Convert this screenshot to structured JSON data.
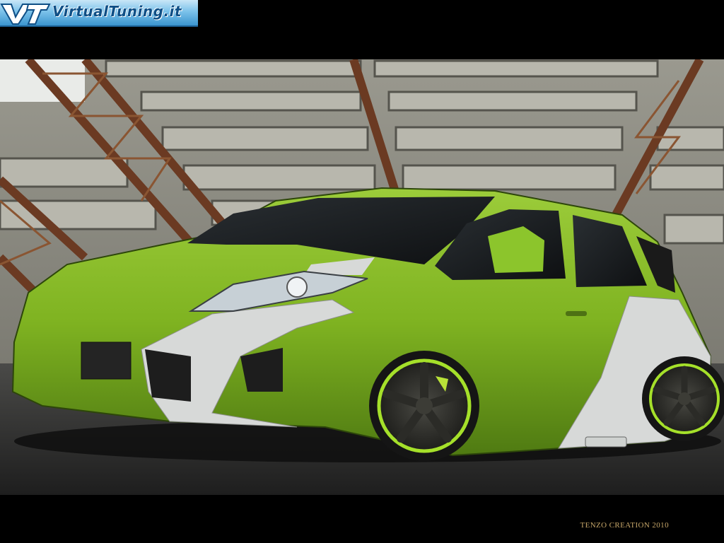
{
  "logo": {
    "text": "VirtualTuning.it",
    "icon": "vt-monogram-icon"
  },
  "photo": {
    "car_color": "#7fb321",
    "stripe_color": "#d7d9d8",
    "rim_accent": "#a5e02a"
  },
  "credit": {
    "text": "TENZO CREATION 2010"
  }
}
